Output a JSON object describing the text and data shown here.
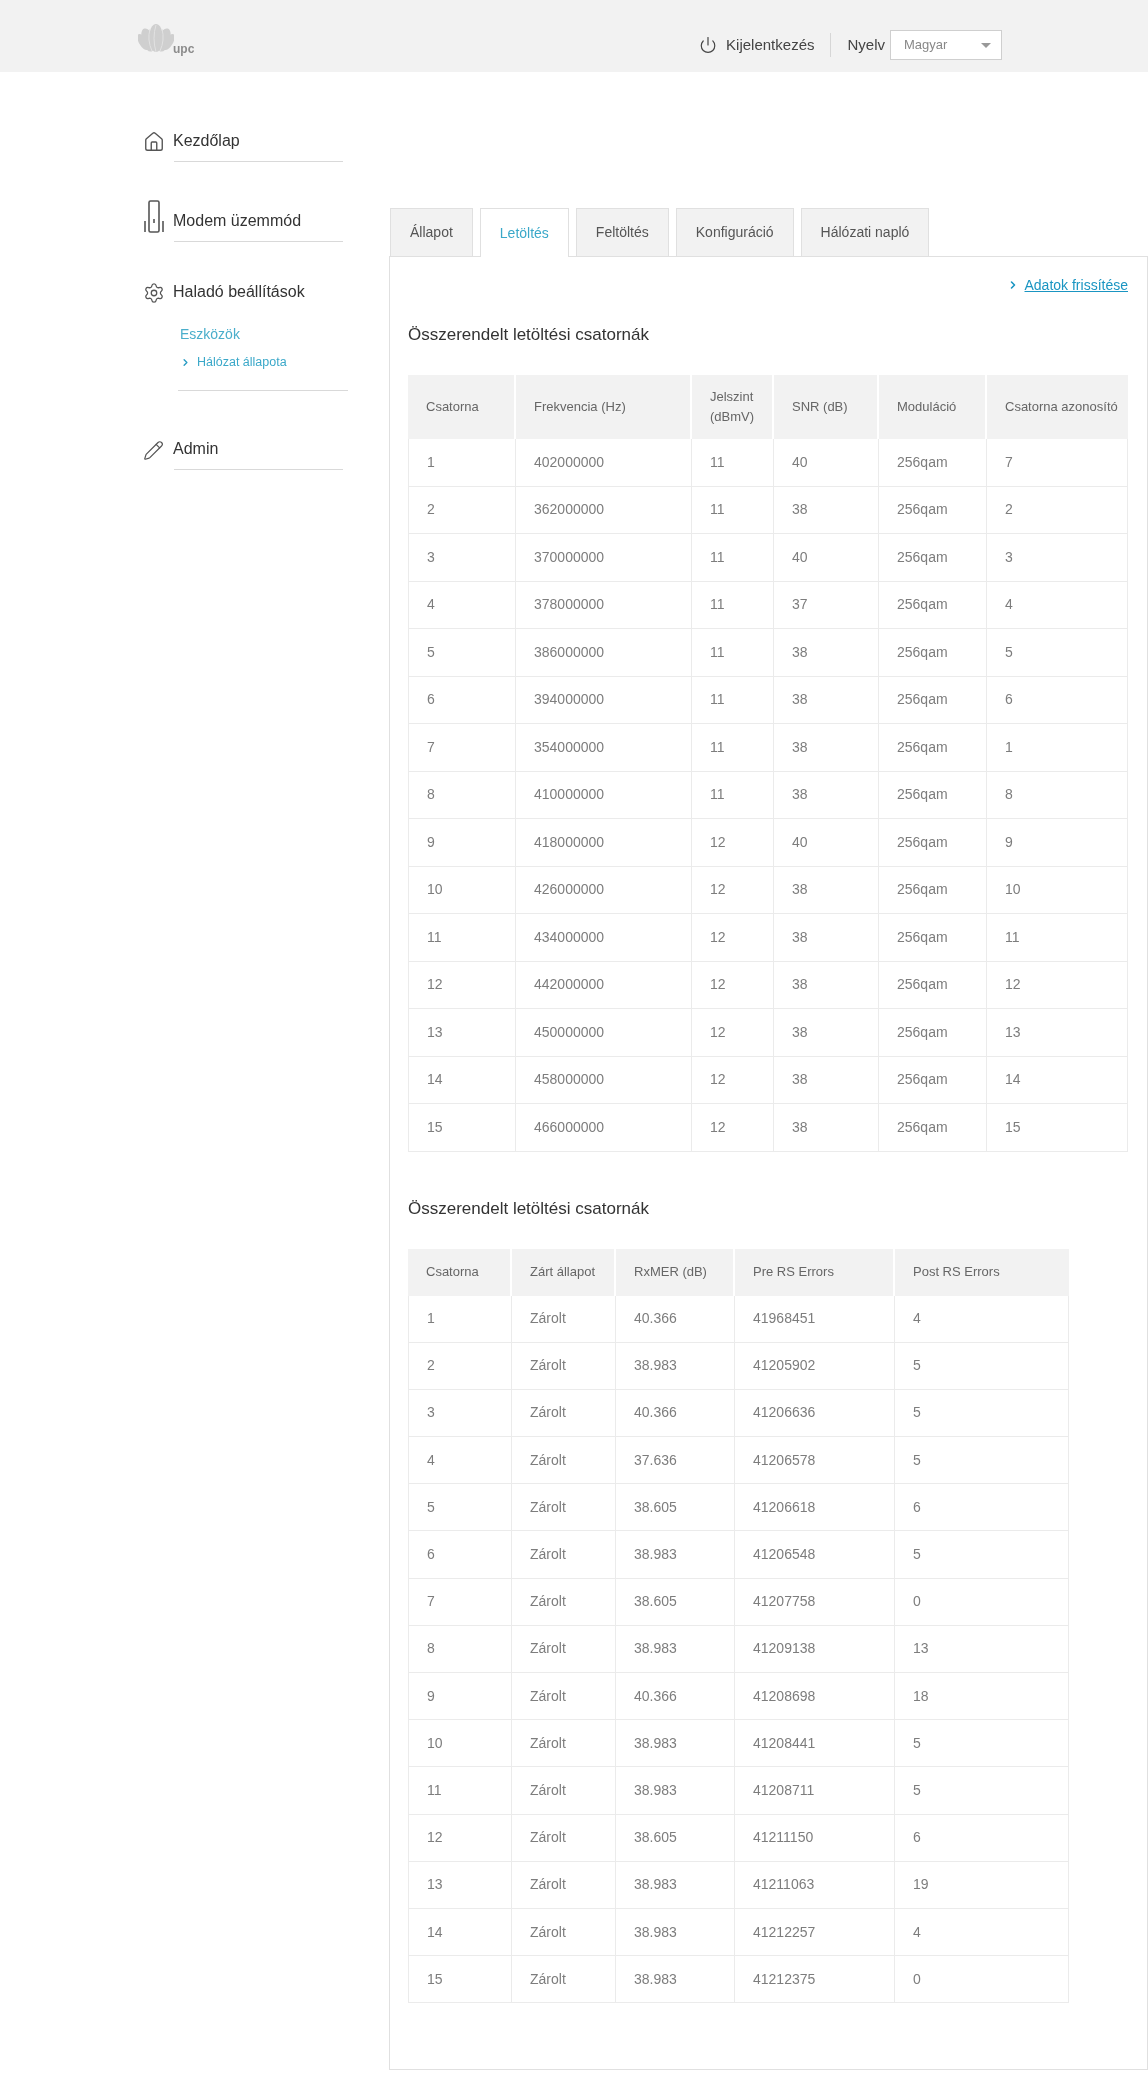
{
  "header": {
    "logo_text": "upc",
    "logout": "Kijelentkezés",
    "language_label": "Nyelv",
    "language_select": {
      "value": "Magyar"
    }
  },
  "sidebar": {
    "items": [
      {
        "label": "Kezdőlap"
      },
      {
        "label": "Modem üzemmód"
      },
      {
        "label": "Haladó beállítások",
        "children": [
          {
            "label": "Eszközök",
            "children": [
              {
                "label": "Hálózat állapota",
                "selected": true
              }
            ]
          }
        ]
      },
      {
        "label": "Admin"
      }
    ]
  },
  "panel": {
    "tabs": [
      {
        "label": "Állapot",
        "selected": false
      },
      {
        "label": "Letöltés",
        "selected": true
      },
      {
        "label": "Feltöltés",
        "selected": false
      },
      {
        "label": "Konfiguráció",
        "selected": false
      },
      {
        "label": "Hálózati napló",
        "selected": false
      }
    ],
    "refresh_link": "Adatok frissítése",
    "sections": [
      {
        "title": "Összerendelt letöltési csatornák",
        "table": {
          "columns": [
            "Csatorna",
            "Frekvencia (Hz)",
            "Jelszint (dBmV)",
            "SNR (dB)",
            "Moduláció",
            "Csatorna azonosító"
          ],
          "rows": [
            [
              "1",
              "402000000",
              "11",
              "40",
              "256qam",
              "7"
            ],
            [
              "2",
              "362000000",
              "11",
              "38",
              "256qam",
              "2"
            ],
            [
              "3",
              "370000000",
              "11",
              "40",
              "256qam",
              "3"
            ],
            [
              "4",
              "378000000",
              "11",
              "37",
              "256qam",
              "4"
            ],
            [
              "5",
              "386000000",
              "11",
              "38",
              "256qam",
              "5"
            ],
            [
              "6",
              "394000000",
              "11",
              "38",
              "256qam",
              "6"
            ],
            [
              "7",
              "354000000",
              "11",
              "38",
              "256qam",
              "1"
            ],
            [
              "8",
              "410000000",
              "11",
              "38",
              "256qam",
              "8"
            ],
            [
              "9",
              "418000000",
              "12",
              "40",
              "256qam",
              "9"
            ],
            [
              "10",
              "426000000",
              "12",
              "38",
              "256qam",
              "10"
            ],
            [
              "11",
              "434000000",
              "12",
              "38",
              "256qam",
              "11"
            ],
            [
              "12",
              "442000000",
              "12",
              "38",
              "256qam",
              "12"
            ],
            [
              "13",
              "450000000",
              "12",
              "38",
              "256qam",
              "13"
            ],
            [
              "14",
              "458000000",
              "12",
              "38",
              "256qam",
              "14"
            ],
            [
              "15",
              "466000000",
              "12",
              "38",
              "256qam",
              "15"
            ]
          ]
        }
      },
      {
        "title": "Összerendelt letöltési csatornák",
        "table": {
          "columns": [
            "Csatorna",
            "Zárt állapot",
            "RxMER (dB)",
            "Pre RS Errors",
            "Post RS Errors"
          ],
          "rows": [
            [
              "1",
              "Zárolt",
              "40.366",
              "41968451",
              "4"
            ],
            [
              "2",
              "Zárolt",
              "38.983",
              "41205902",
              "5"
            ],
            [
              "3",
              "Zárolt",
              "40.366",
              "41206636",
              "5"
            ],
            [
              "4",
              "Zárolt",
              "37.636",
              "41206578",
              "5"
            ],
            [
              "5",
              "Zárolt",
              "38.605",
              "41206618",
              "6"
            ],
            [
              "6",
              "Zárolt",
              "38.983",
              "41206548",
              "5"
            ],
            [
              "7",
              "Zárolt",
              "38.605",
              "41207758",
              "0"
            ],
            [
              "8",
              "Zárolt",
              "38.983",
              "41209138",
              "13"
            ],
            [
              "9",
              "Zárolt",
              "40.366",
              "41208698",
              "18"
            ],
            [
              "10",
              "Zárolt",
              "38.983",
              "41208441",
              "5"
            ],
            [
              "11",
              "Zárolt",
              "38.983",
              "41208711",
              "5"
            ],
            [
              "12",
              "Zárolt",
              "38.605",
              "41211150",
              "6"
            ],
            [
              "13",
              "Zárolt",
              "38.983",
              "41211063",
              "19"
            ],
            [
              "14",
              "Zárolt",
              "38.983",
              "41212257",
              "4"
            ],
            [
              "15",
              "Zárolt",
              "38.983",
              "41212375",
              "0"
            ]
          ]
        }
      }
    ]
  }
}
